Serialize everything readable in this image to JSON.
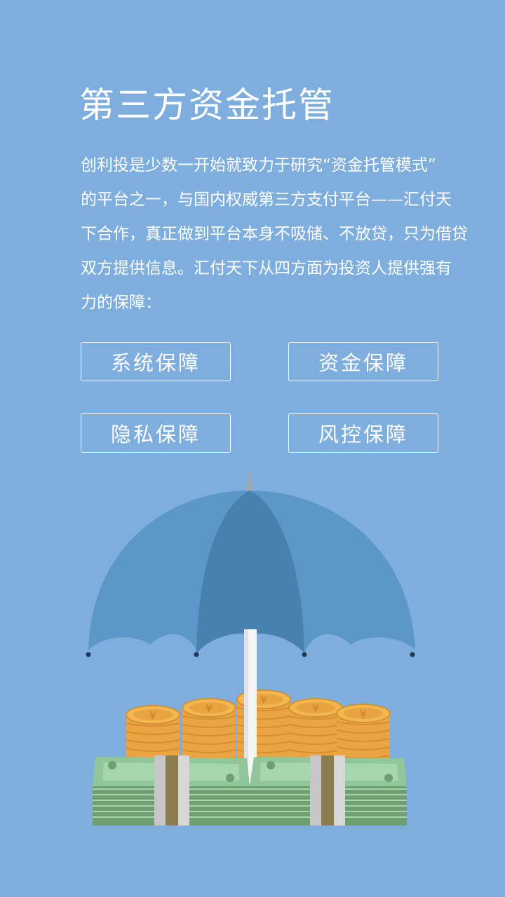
{
  "page": {
    "title": "第三方资金托管",
    "intro_lines": [
      "创利投是少数一开始就致力于研究“资金托管模式”",
      "的平台之一，与国内权威第三方支付平台——汇付天",
      "下合作，真正做到平台本身不吸储、不放贷，只为借贷",
      "双方提供信息。汇付天下从四方面为投资人提供强有",
      "力的保障："
    ]
  },
  "buttons": [
    {
      "label": "系统保障"
    },
    {
      "label": "资金保障"
    },
    {
      "label": "隐私保障"
    },
    {
      "label": "风控保障"
    }
  ],
  "illustration": {
    "icon": "umbrella-over-money-icon",
    "coin_symbol": "¥"
  },
  "colors": {
    "background": "#7eaedd",
    "umbrella_light": "#5b97c8",
    "umbrella_dark": "#4a80ad",
    "coin": "#f3b74f",
    "cash": "#8fc79a"
  }
}
